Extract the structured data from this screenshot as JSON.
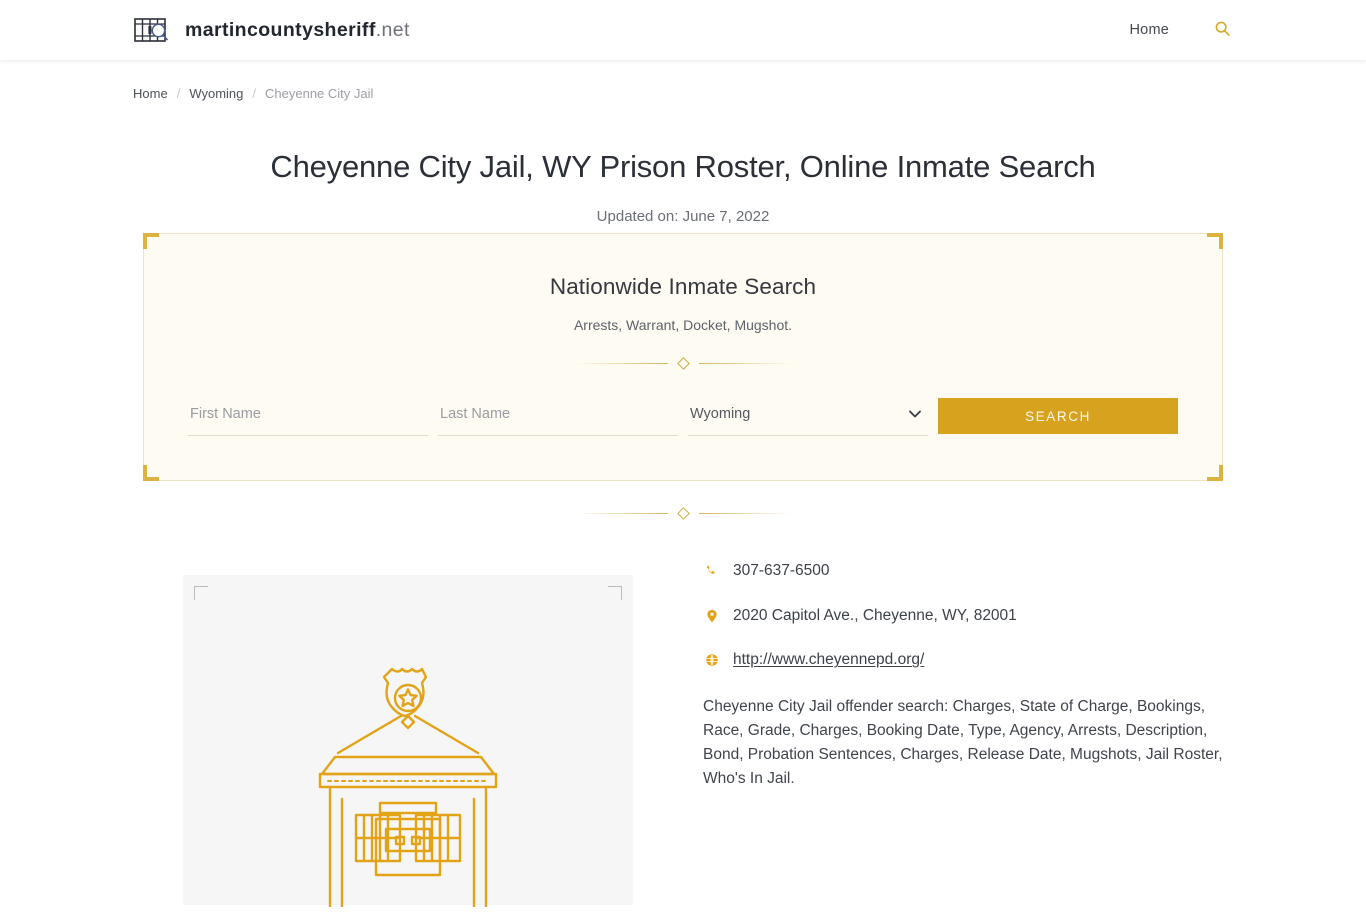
{
  "header": {
    "brand_strong": "martincountysheriff",
    "brand_light": ".net",
    "brand_icon": "jail-bars-magnifier-icon",
    "nav": [
      {
        "label": "Home",
        "icon": ""
      }
    ],
    "search_icon": "search-icon"
  },
  "breadcrumb": {
    "items": [
      {
        "label": "Home",
        "current": false
      },
      {
        "label": "Wyoming",
        "current": false
      },
      {
        "label": "Cheyenne City Jail",
        "current": true
      }
    ],
    "separator": "/"
  },
  "page": {
    "title": "Cheyenne City Jail, WY Prison Roster, Online Inmate Search",
    "updated": "Updated on: June 7, 2022"
  },
  "search_panel": {
    "title": "Nationwide Inmate Search",
    "subtitle": "Arrests, Warrant, Docket, Mugshot.",
    "first_name_placeholder": "First Name",
    "first_name_value": "",
    "last_name_placeholder": "Last Name",
    "last_name_value": "",
    "state_selected": "Wyoming",
    "state_options": [
      "Wyoming"
    ],
    "submit_label": "SEARCH",
    "accent_color": "#d7a31f",
    "panel_bg": "#fdfbf2",
    "corner_color": "#dcb341"
  },
  "figure": {
    "alt": "jail-building-badge-illustration",
    "art_color": "#e2a318",
    "bg_color": "#f6f6f6"
  },
  "details": {
    "phone": "307-637-6500",
    "phone_icon": "phone-icon",
    "address": "2020 Capitol Ave., Cheyenne, WY, 82001",
    "address_icon": "map-pin-icon",
    "website": "http://www.cheyennepd.org/",
    "website_icon": "globe-icon",
    "description": "Cheyenne City Jail offender search: Charges, State of Charge, Bookings, Race, Grade, Charges, Booking Date, Type, Agency, Arrests, Description, Bond, Probation Sentences, Charges, Release Date, Mugshots, Jail Roster, Who's In Jail."
  }
}
